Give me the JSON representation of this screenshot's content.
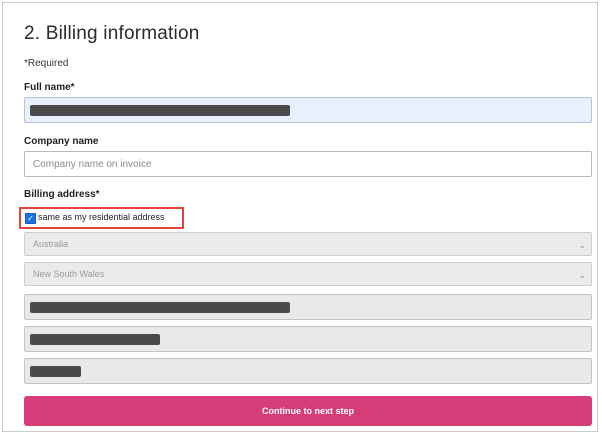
{
  "section": {
    "title": "2. Billing information",
    "required_note": "*Required"
  },
  "full_name": {
    "label": "Full name*",
    "value": "[redacted]"
  },
  "company_name": {
    "label": "Company name",
    "placeholder": "Company name on invoice",
    "value": ""
  },
  "billing_address": {
    "label": "Billing address*",
    "same_as_residential": {
      "label": "same as my residential address",
      "checked": true
    },
    "country": {
      "selected": "Australia"
    },
    "state": {
      "selected": "New South Wales"
    },
    "street": "[redacted]",
    "suburb": "[redacted]",
    "postcode": "[redacted]"
  },
  "actions": {
    "continue_label": "Continue to next step"
  },
  "colors": {
    "accent": "#d63d78",
    "highlight": "#e0433a",
    "checkbox": "#1a73e8",
    "autofill": "#e8f0fd"
  },
  "icons": {
    "select_chevron": "chevron-down-icon",
    "checkbox_check": "checkmark-icon"
  }
}
